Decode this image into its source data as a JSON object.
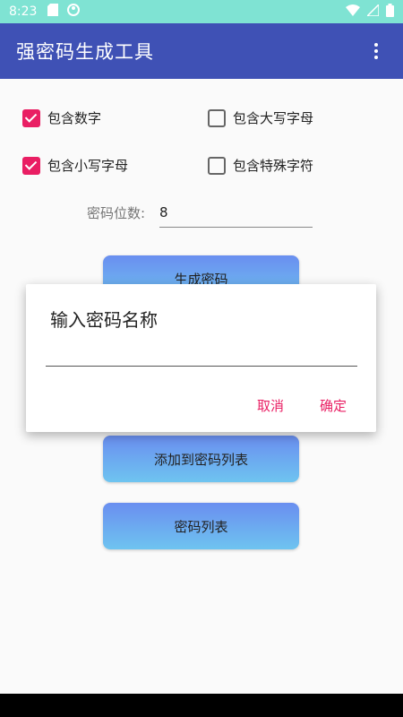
{
  "status_bar": {
    "time": "8:23",
    "icons_left": [
      "sd-card-icon",
      "circle-face-icon"
    ],
    "icons_right": [
      "wifi-icon",
      "signal-icon",
      "battery-icon"
    ]
  },
  "app_bar": {
    "title": "强密码生成工具",
    "menu_icon": "more-vert-icon"
  },
  "options": {
    "include_digits": {
      "label": "包含数字",
      "checked": true
    },
    "include_uppercase": {
      "label": "包含大写字母",
      "checked": false
    },
    "include_lowercase": {
      "label": "包含小写字母",
      "checked": true
    },
    "include_special": {
      "label": "包含特殊字符",
      "checked": false
    }
  },
  "length": {
    "label": "密码位数:",
    "value": "8"
  },
  "buttons": {
    "generate": "生成密码",
    "add_to_list": "添加到密码列表",
    "password_list": "密码列表"
  },
  "dialog": {
    "title": "输入密码名称",
    "input_value": "",
    "cancel": "取消",
    "confirm": "确定"
  },
  "colors": {
    "app_bar": "#3f51b5",
    "status_bar": "#7fe3d3",
    "accent": "#e91e63"
  }
}
